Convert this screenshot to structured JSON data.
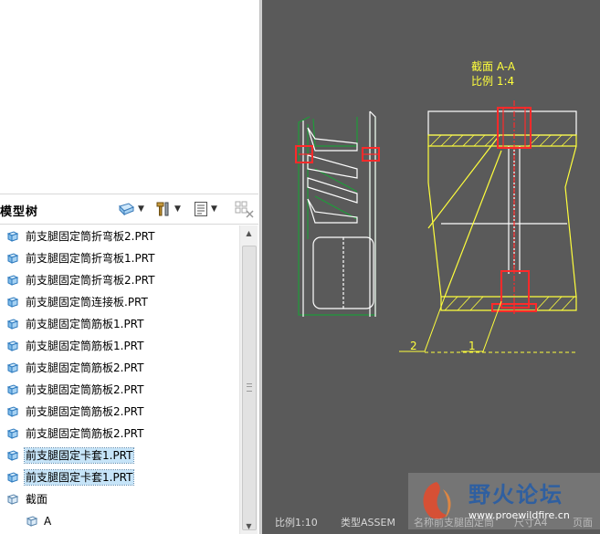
{
  "model_tree": {
    "title": "模型树",
    "items": [
      {
        "label": "前支腿固定筒折弯板2.PRT",
        "selected": false
      },
      {
        "label": "前支腿固定筒折弯板1.PRT",
        "selected": false
      },
      {
        "label": "前支腿固定筒折弯板2.PRT",
        "selected": false
      },
      {
        "label": "前支腿固定筒连接板.PRT",
        "selected": false
      },
      {
        "label": "前支腿固定筒筋板1.PRT",
        "selected": false
      },
      {
        "label": "前支腿固定筒筋板1.PRT",
        "selected": false
      },
      {
        "label": "前支腿固定筒筋板2.PRT",
        "selected": false
      },
      {
        "label": "前支腿固定筒筋板2.PRT",
        "selected": false
      },
      {
        "label": "前支腿固定筒筋板2.PRT",
        "selected": false
      },
      {
        "label": "前支腿固定筒筋板2.PRT",
        "selected": false
      },
      {
        "label": "前支腿固定卡套1.PRT",
        "selected": true
      },
      {
        "label": "前支腿固定卡套1.PRT",
        "selected": true
      }
    ],
    "section_folder": "截面",
    "section_item": "A"
  },
  "toolbar": {
    "icons": [
      "display-icon",
      "settings-hammer-icon",
      "tree-filter-icon",
      "columns-icon"
    ]
  },
  "drawing": {
    "section_title": "截面  A-A",
    "section_scale": "比例  1:4",
    "callout_1": "1",
    "callout_2": "2",
    "colors": {
      "background": "#5a5a5a",
      "yellow": "#ffff3c",
      "red": "#ff2a2a",
      "green": "#1f9b3a",
      "white": "#ffffff"
    }
  },
  "status": {
    "scale": "比例1:10",
    "type": "类型ASSEM",
    "name": "名称前支腿固定筒",
    "sheet": "尺寸A4",
    "extra": "页面"
  },
  "watermark": {
    "text": "野火论坛",
    "url": "www.proewildfire.cn"
  }
}
